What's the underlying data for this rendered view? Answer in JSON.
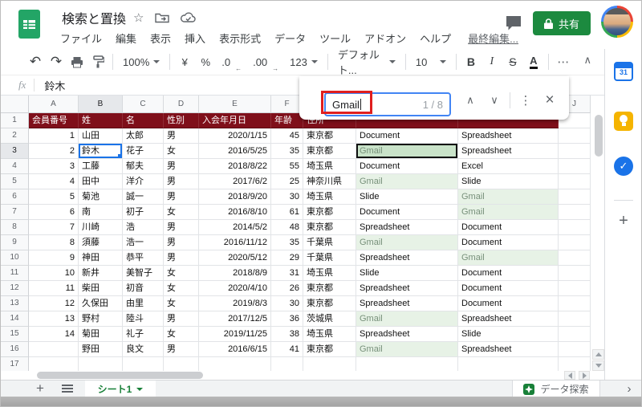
{
  "titlebar": {
    "title": "検索と置換",
    "menus": [
      "ファイル",
      "編集",
      "表示",
      "挿入",
      "表示形式",
      "データ",
      "ツール",
      "アドオン",
      "ヘルプ"
    ],
    "last_edit_label": "最終編集...",
    "share_label": "共有"
  },
  "toolbar": {
    "zoom_value": "100%",
    "currency_label": "¥",
    "percent_label": "%",
    "decimal_decrease": ".0",
    "decimal_increase": ".00",
    "number_format": "123",
    "font_family_value": "デフォルト...",
    "font_size_value": "10"
  },
  "formula_bar": {
    "fx_label": "fx",
    "cell_value": "鈴木"
  },
  "find_bar": {
    "query": "Gmail",
    "match_count": "1 / 8"
  },
  "grid": {
    "column_letters": [
      "A",
      "B",
      "C",
      "D",
      "E",
      "F",
      "G",
      "H",
      "I",
      "J"
    ],
    "selected_column": "B",
    "selected_row": 3,
    "header_row": [
      "会員番号",
      "姓",
      "名",
      "性別",
      "入会年月日",
      "年齢",
      "住所",
      "",
      ""
    ],
    "rows": [
      {
        "n": 2,
        "cells": [
          "1",
          "山田",
          "太郎",
          "男",
          "2020/1/15",
          "45",
          "東京都",
          "Document",
          "Spreadsheet"
        ]
      },
      {
        "n": 3,
        "cells": [
          "2",
          "鈴木",
          "花子",
          "女",
          "2016/5/25",
          "35",
          "東京都",
          "Gmail",
          "Spreadsheet"
        ]
      },
      {
        "n": 4,
        "cells": [
          "3",
          "工藤",
          "郁夫",
          "男",
          "2018/8/22",
          "55",
          "埼玉県",
          "Document",
          "Excel"
        ]
      },
      {
        "n": 5,
        "cells": [
          "4",
          "田中",
          "洋介",
          "男",
          "2017/6/2",
          "25",
          "神奈川県",
          "Gmail",
          "Slide"
        ]
      },
      {
        "n": 6,
        "cells": [
          "5",
          "菊池",
          "誠一",
          "男",
          "2018/9/20",
          "30",
          "埼玉県",
          "Slide",
          "Gmail"
        ]
      },
      {
        "n": 7,
        "cells": [
          "6",
          "南",
          "初子",
          "女",
          "2016/8/10",
          "61",
          "東京都",
          "Document",
          "Gmail"
        ]
      },
      {
        "n": 8,
        "cells": [
          "7",
          "川崎",
          "浩",
          "男",
          "2014/5/2",
          "48",
          "東京都",
          "Spreadsheet",
          "Document"
        ]
      },
      {
        "n": 9,
        "cells": [
          "8",
          "須藤",
          "浩一",
          "男",
          "2016/11/12",
          "35",
          "千葉県",
          "Gmail",
          "Document"
        ]
      },
      {
        "n": 10,
        "cells": [
          "9",
          "神田",
          "恭平",
          "男",
          "2020/5/12",
          "29",
          "千葉県",
          "Spreadsheet",
          "Gmail"
        ]
      },
      {
        "n": 11,
        "cells": [
          "10",
          "新井",
          "美智子",
          "女",
          "2018/8/9",
          "31",
          "埼玉県",
          "Slide",
          "Document"
        ]
      },
      {
        "n": 12,
        "cells": [
          "11",
          "柴田",
          "初音",
          "女",
          "2020/4/10",
          "26",
          "東京都",
          "Spreadsheet",
          "Document"
        ]
      },
      {
        "n": 13,
        "cells": [
          "12",
          "久保田",
          "由里",
          "女",
          "2019/8/3",
          "30",
          "東京都",
          "Spreadsheet",
          "Document"
        ]
      },
      {
        "n": 14,
        "cells": [
          "13",
          "野村",
          "陸斗",
          "男",
          "2017/12/5",
          "36",
          "茨城県",
          "Gmail",
          "Spreadsheet"
        ]
      },
      {
        "n": 15,
        "cells": [
          "14",
          "菊田",
          "礼子",
          "女",
          "2019/11/25",
          "38",
          "埼玉県",
          "Spreadsheet",
          "Slide"
        ]
      },
      {
        "n": 16,
        "cells": [
          "",
          "野田",
          "良文",
          "男",
          "2016/6/15",
          "41",
          "東京都",
          "Gmail",
          "Spreadsheet"
        ]
      },
      {
        "n": 17,
        "cells": [
          "",
          "",
          "",
          "",
          "",
          "",
          "",
          "",
          ""
        ]
      }
    ],
    "current_match": {
      "row": 3,
      "col_letter": "H"
    },
    "selected_cell": {
      "row": 3,
      "col_letter": "B"
    }
  },
  "sheet_bar": {
    "sheet_name": "シート1",
    "explore_label": "データ探索"
  },
  "colors": {
    "header_row_bg": "#7f0f1a",
    "match_bg": "#e7f2e6",
    "current_match_bg": "#c9e3c9",
    "share_button_bg": "#1c8a3f",
    "find_input_border": "#4285f4",
    "annotation_red": "#e01f1f",
    "accent_green": "#188038",
    "selection_blue": "#1a73e8"
  }
}
